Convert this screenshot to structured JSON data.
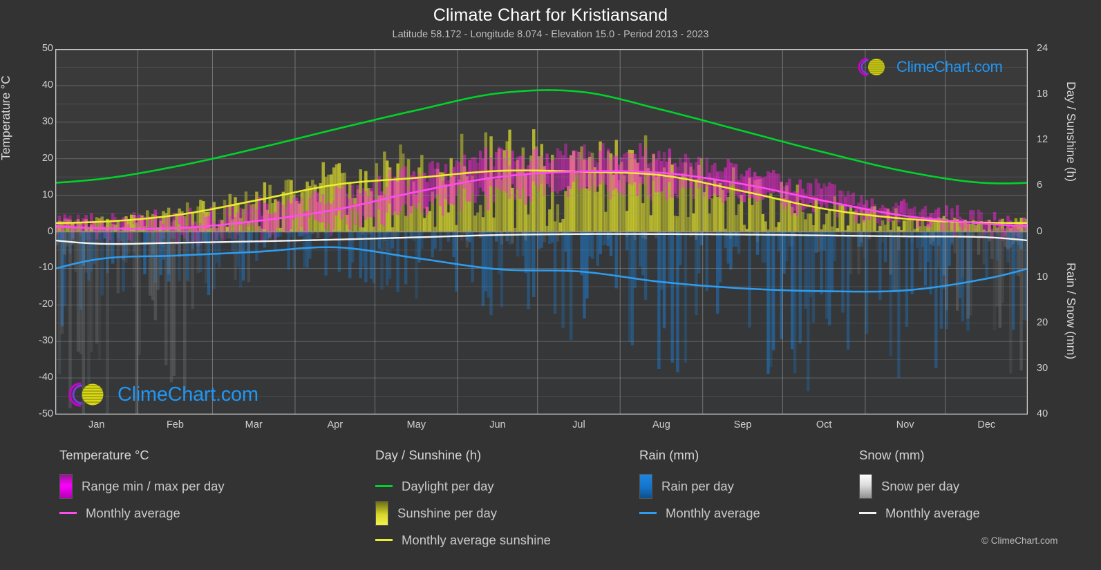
{
  "header": {
    "title": "Climate Chart for Kristiansand",
    "subtitle": "Latitude 58.172 - Longitude 8.074 - Elevation 15.0 - Period 2013 - 2023"
  },
  "watermark": {
    "text": "ClimeChart.com"
  },
  "copyright": "© ClimeChart.com",
  "axes": {
    "left_label": "Temperature °C",
    "right_top_label": "Day / Sunshine (h)",
    "right_bottom_label": "Rain / Snow (mm)",
    "left_ticks": [
      "50",
      "40",
      "30",
      "20",
      "10",
      "0",
      "-10",
      "-20",
      "-30",
      "-40",
      "-50"
    ],
    "right_top_ticks": [
      "24",
      "18",
      "12",
      "6",
      "0"
    ],
    "right_bottom_ticks": [
      "10",
      "20",
      "30",
      "40"
    ],
    "x_ticks": [
      "Jan",
      "Feb",
      "Mar",
      "Apr",
      "May",
      "Jun",
      "Jul",
      "Aug",
      "Sep",
      "Oct",
      "Nov",
      "Dec"
    ]
  },
  "legend": {
    "temperature": {
      "title": "Temperature °C",
      "items": [
        {
          "label": "Range min / max per day",
          "swatch": "box",
          "color": "#ff00ff"
        },
        {
          "label": "Monthly average",
          "swatch": "line",
          "color": "#ff4ded"
        }
      ]
    },
    "sunshine": {
      "title": "Day / Sunshine (h)",
      "items": [
        {
          "label": "Daylight per day",
          "swatch": "line",
          "color": "#00d42a"
        },
        {
          "label": "Sunshine per day",
          "swatch": "box",
          "color": "#e8e832"
        },
        {
          "label": "Monthly average sunshine",
          "swatch": "line",
          "color": "#ecec30"
        }
      ]
    },
    "rain": {
      "title": "Rain (mm)",
      "items": [
        {
          "label": "Rain per day",
          "swatch": "box",
          "color": "#1f86e0"
        },
        {
          "label": "Monthly average",
          "swatch": "line",
          "color": "#2f9ced"
        }
      ]
    },
    "snow": {
      "title": "Snow (mm)",
      "items": [
        {
          "label": "Snow per day",
          "swatch": "box",
          "color": "#ffffff"
        },
        {
          "label": "Monthly average",
          "swatch": "line",
          "color": "#f2f2f2"
        }
      ]
    }
  },
  "colors": {
    "background": "#333333",
    "plot_background": "#3a3a3a",
    "grid": "#8a8a8a",
    "daylight": "#00d42a",
    "sunshine": "#ecec30",
    "temperature": "#ff4ded",
    "rain": "#2f9ced",
    "snow": "#f2f2f2",
    "logo_blue": "#2196f3",
    "logo_magenta": "#cc00cc",
    "logo_yellow": "#d8d814"
  },
  "chart_data": {
    "type": "line",
    "title": "Climate Chart for Kristiansand",
    "subtitle": "Latitude 58.172 - Longitude 8.074 - Elevation 15.0 - Period 2013 - 2023",
    "xlabel": "",
    "ylabel": "Temperature °C",
    "ylabel_right_top": "Day / Sunshine (h)",
    "ylabel_right_bottom": "Rain / Snow (mm)",
    "ylim": [
      -50,
      50
    ],
    "ylim_right_top": [
      0,
      24
    ],
    "ylim_right_bottom": [
      0,
      40
    ],
    "grid": true,
    "legend_position": "below",
    "categories": [
      "Jan",
      "Feb",
      "Mar",
      "Apr",
      "May",
      "Jun",
      "Jul",
      "Aug",
      "Sep",
      "Oct",
      "Nov",
      "Dec"
    ],
    "series": [
      {
        "name": "Daylight per day",
        "unit": "h",
        "axis": "right_top",
        "color": "#00d42a",
        "values": [
          6.9,
          8.6,
          10.9,
          13.5,
          16.0,
          18.2,
          18.4,
          16.0,
          13.2,
          10.4,
          7.9,
          6.4
        ]
      },
      {
        "name": "Monthly average sunshine",
        "unit": "h",
        "axis": "right_top",
        "color": "#ecec30",
        "values": [
          1.3,
          2.2,
          4.1,
          6.2,
          7.1,
          8.0,
          7.9,
          7.4,
          5.3,
          3.0,
          1.7,
          1.2
        ]
      },
      {
        "name": "Temperature monthly average",
        "unit": "°C",
        "axis": "left",
        "color": "#ff4ded",
        "values": [
          1.0,
          1.0,
          2.9,
          6.1,
          11.0,
          15.0,
          16.5,
          16.1,
          13.0,
          8.4,
          4.3,
          2.2
        ]
      },
      {
        "name": "Rain monthly average",
        "unit": "mm",
        "axis": "right_bottom",
        "color": "#2f9ced",
        "values": [
          6.0,
          5.2,
          4.4,
          3.4,
          5.8,
          8.2,
          8.7,
          11.0,
          12.4,
          13.0,
          12.8,
          10.2
        ]
      },
      {
        "name": "Snow monthly average",
        "unit": "mm",
        "axis": "right_bottom",
        "color": "#f2f2f2",
        "values": [
          2.6,
          2.4,
          2.1,
          1.7,
          1.2,
          0.7,
          0.5,
          0.5,
          0.6,
          0.8,
          1.0,
          1.2
        ]
      }
    ],
    "daily_bands": [
      {
        "name": "Range min / max per day",
        "axis": "left",
        "color": "#ff00ff",
        "type": "vertical-bars"
      },
      {
        "name": "Sunshine per day",
        "axis": "right_top",
        "color": "#e8e832",
        "type": "vertical-bars"
      },
      {
        "name": "Rain per day",
        "axis": "right_bottom",
        "color": "#1f86e0",
        "type": "vertical-bars"
      },
      {
        "name": "Snow per day",
        "axis": "right_bottom",
        "color": "#ffffff",
        "type": "vertical-bars"
      }
    ]
  }
}
